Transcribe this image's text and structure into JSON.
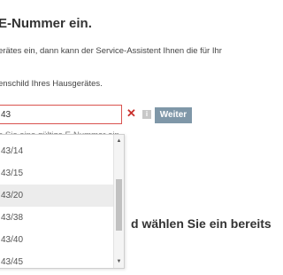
{
  "page": {
    "heading": "E-Nummer ein.",
    "intro_text": "erätes ein, dann kann der Service-Assistent Ihnen die für Ihr",
    "hint_text": "enschild Ihres Hausgerätes.",
    "section_heading": "d wählen Sie ein bereits"
  },
  "form": {
    "enr_value": "43",
    "clear_label": "✕",
    "info_label": "i",
    "submit_label": "Weiter",
    "error_text": "e Sie eine gültige E-Nummer ein."
  },
  "dropdown": {
    "top_partial": "",
    "items": [
      "43/14",
      "43/15",
      "43/20",
      "43/38",
      "43/40",
      "43/45"
    ],
    "highlighted_index": 2,
    "scroll_up_icon": "▲",
    "scroll_down_icon": "▼"
  },
  "colors": {
    "error_border": "#d9534f",
    "clear_icon": "#c9302c",
    "button_bg": "#7f97a8",
    "highlight_bg": "#ececec"
  }
}
